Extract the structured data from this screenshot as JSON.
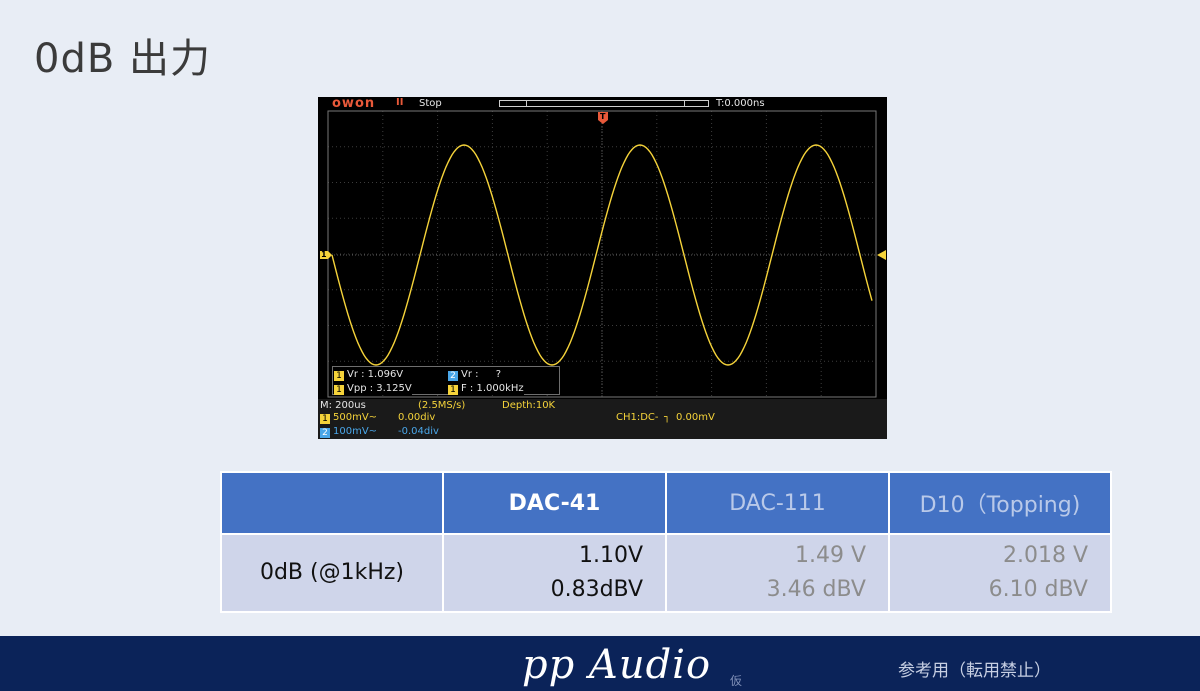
{
  "title": "0dB 出力",
  "scope": {
    "logo": "owon",
    "pause_symbol": "II",
    "status": "Stop",
    "trigger_time": "T:0.000ns",
    "trigger_marker": "T",
    "ch1_marker": "1",
    "measurements": {
      "ch1_vr": "Vr : 1.096V",
      "ch1_vpp": "Vpp : 3.125V",
      "ch2_vr": "Vr :",
      "ch2_vr_value": "?",
      "ch1_freq": "F : 1.000kHz"
    },
    "timebase": "M: 200us",
    "sample_rate": "(2.5MS/s)",
    "depth": "Depth:10K",
    "ch1_scale": "500mV~",
    "ch1_offset": "0.00div",
    "ch2_scale": "100mV~",
    "ch2_offset": "-0.04div",
    "trigger_info": "CH1:DC-",
    "trigger_level": "0.00mV",
    "colors": {
      "ch1": "#f5d33a",
      "ch2": "#4aa6e8",
      "accent": "#e8593a"
    }
  },
  "table": {
    "headers": [
      "",
      "DAC-41",
      "DAC-111",
      "D10（Topping)"
    ],
    "row_label": "0dB (@1kHz)",
    "cells": [
      {
        "line1": "1.10V",
        "line2": "0.83dBV"
      },
      {
        "line1": "1.49 V",
        "line2": "3.46 dBV"
      },
      {
        "line1": "2.018 V",
        "line2": "6.10 dBV"
      }
    ],
    "colors": {
      "header": "#4472c4",
      "cell": "#cfd5ea"
    }
  },
  "footer": {
    "brand": "pp Audio",
    "sub": "仮",
    "note": "参考用（転用禁止）",
    "background": "#0b2359"
  }
}
